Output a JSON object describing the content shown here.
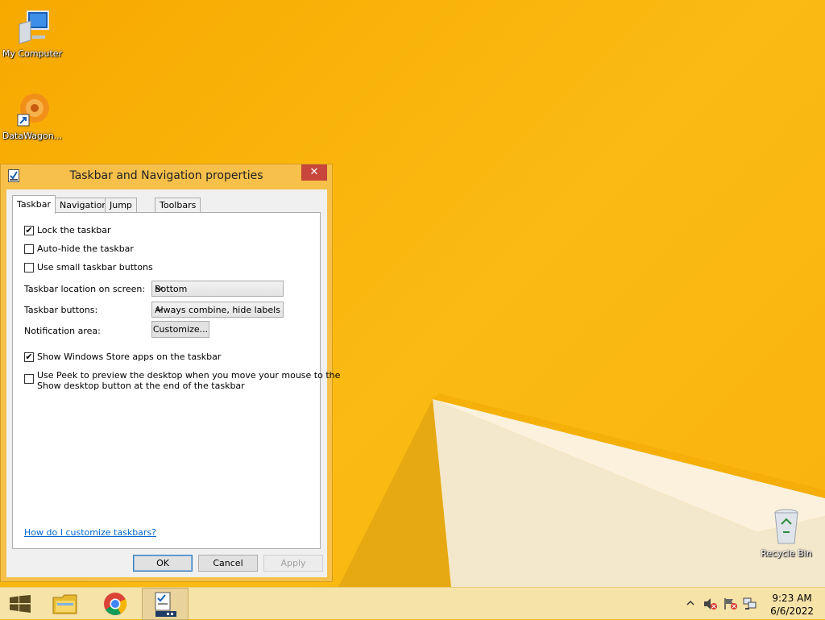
{
  "desktop": {
    "icons": [
      {
        "label": "My Computer"
      },
      {
        "label": "DataWagon..."
      },
      {
        "label": "Recycle Bin"
      }
    ]
  },
  "window": {
    "title": "Taskbar and Navigation properties",
    "close_glyph": "✕",
    "tabs": [
      "Taskbar",
      "Navigation",
      "Jump Lists",
      "Toolbars"
    ],
    "active_tab": "Taskbar",
    "checkboxes": {
      "lock": {
        "label": "Lock the taskbar",
        "checked": true
      },
      "autohide": {
        "label": "Auto-hide the taskbar",
        "checked": false
      },
      "small": {
        "label": "Use small taskbar buttons",
        "checked": false
      },
      "store": {
        "label": "Show Windows Store apps on the taskbar",
        "checked": true
      },
      "peek": {
        "label_line1": "Use Peek to preview the desktop when you move your mouse to the",
        "label_line2": "Show desktop button at the end of the taskbar",
        "checked": false
      }
    },
    "location": {
      "label": "Taskbar location on screen:",
      "value": "Bottom"
    },
    "buttons": {
      "label": "Taskbar buttons:",
      "value": "Always combine, hide labels"
    },
    "notification": {
      "label": "Notification area:",
      "button": "Customize..."
    },
    "help_link": "How do I customize taskbars?",
    "ok": "OK",
    "cancel": "Cancel",
    "apply": "Apply"
  },
  "taskbar": {
    "time": "9:23 AM",
    "date": "6/6/2022"
  },
  "colors": {
    "wallpaper": "#f9b60a",
    "window_frame": "#f6c04a",
    "close": "#c7463b",
    "taskbar": "#f6e3a8",
    "link": "#0066cc"
  }
}
